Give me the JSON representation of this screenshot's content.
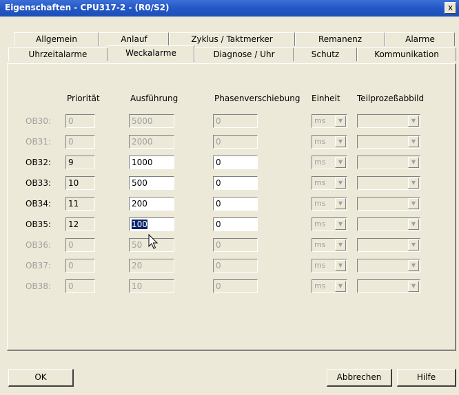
{
  "window": {
    "title": "Eigenschaften - CPU317-2 - (R0/S2)",
    "close_label": "x"
  },
  "tabs_row1": [
    "Allgemein",
    "Anlauf",
    "Zyklus / Taktmerker",
    "Remanenz",
    "Alarme"
  ],
  "tabs_row2": [
    "Uhrzeitalarme",
    "Weckalarme",
    "Diagnose / Uhr",
    "Schutz",
    "Kommunikation"
  ],
  "active_tab": "Weckalarme",
  "headers": {
    "prioritaet": "Priorität",
    "ausfuehrung": "Ausführung",
    "phasen": "Phasenverschiebung",
    "einheit": "Einheit",
    "teilprozess": "Teilprozeßabbild"
  },
  "rows": [
    {
      "label": "OB30:",
      "prio": "0",
      "ausf": "5000",
      "phase": "0",
      "unit": "ms"
    },
    {
      "label": "OB31:",
      "prio": "0",
      "ausf": "2000",
      "phase": "0",
      "unit": "ms"
    },
    {
      "label": "OB32:",
      "prio": "9",
      "ausf": "1000",
      "phase": "0",
      "unit": "ms"
    },
    {
      "label": "OB33:",
      "prio": "10",
      "ausf": "500",
      "phase": "0",
      "unit": "ms"
    },
    {
      "label": "OB34:",
      "prio": "11",
      "ausf": "200",
      "phase": "0",
      "unit": "ms"
    },
    {
      "label": "OB35:",
      "prio": "12",
      "ausf": "100",
      "phase": "0",
      "unit": "ms"
    },
    {
      "label": "OB36:",
      "prio": "0",
      "ausf": "50",
      "phase": "0",
      "unit": "ms"
    },
    {
      "label": "OB37:",
      "prio": "0",
      "ausf": "20",
      "phase": "0",
      "unit": "ms"
    },
    {
      "label": "OB38:",
      "prio": "0",
      "ausf": "10",
      "phase": "0",
      "unit": "ms"
    }
  ],
  "buttons": {
    "ok": "OK",
    "cancel": "Abbrechen",
    "help": "Hilfe"
  }
}
